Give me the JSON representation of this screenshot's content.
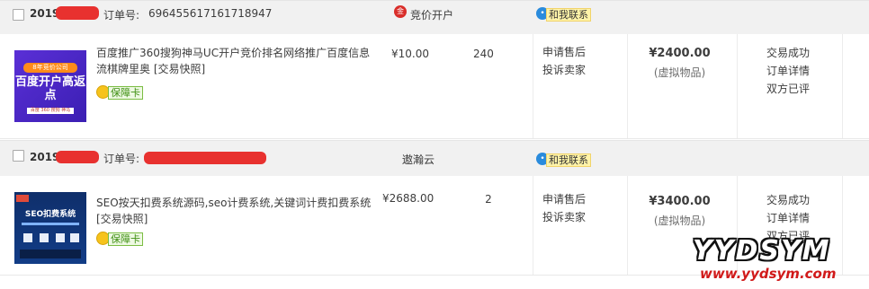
{
  "orders": [
    {
      "date_prefix": "2019",
      "order_no_label": "订单号:",
      "order_no": "696455617161718947",
      "shop_name": "竞价开户",
      "shop_icon_glyph": "金",
      "contact_label": "和我联系",
      "item": {
        "title": "百度推广360搜狗神马UC开户竞价排名网络推广百度信息流棋牌里奥 [交易快照]",
        "thumb": {
          "top": "8年竞价公司",
          "big": "百度开户高返点",
          "small": "百度 360 搜狗 神马"
        },
        "guarantee_label": "保障卡",
        "unit_price": "¥10.00",
        "quantity": "240",
        "aftersale": [
          "申请售后",
          "投诉卖家"
        ],
        "total": "¥2400.00",
        "total_note": "(虚拟物品)",
        "status": [
          "交易成功",
          "订单详情",
          "双方已评"
        ]
      }
    },
    {
      "date_prefix": "2019",
      "order_no_label": "订单号:",
      "order_no": "",
      "shop_name": "遨瀚云",
      "contact_label": "和我联系",
      "item": {
        "title": "SEO按天扣费系统源码,seo计费系统,关键词计费扣费系统 [交易快照]",
        "thumb": {
          "title": "SEO扣费系统"
        },
        "guarantee_label": "保障卡",
        "unit_price": "¥2688.00",
        "quantity": "2",
        "aftersale": [
          "申请售后",
          "投诉卖家"
        ],
        "total": "¥3400.00",
        "total_note": "(虚拟物品)",
        "status": [
          "交易成功",
          "订单详情",
          "双方已评"
        ]
      }
    }
  ],
  "watermark": {
    "brand": "YYDSYM",
    "url": "www.yydsym.com"
  },
  "colors": {
    "redaction": "#e8312f",
    "contact_bg": "#fff3a8",
    "guarantee_text": "#3f8f12"
  }
}
